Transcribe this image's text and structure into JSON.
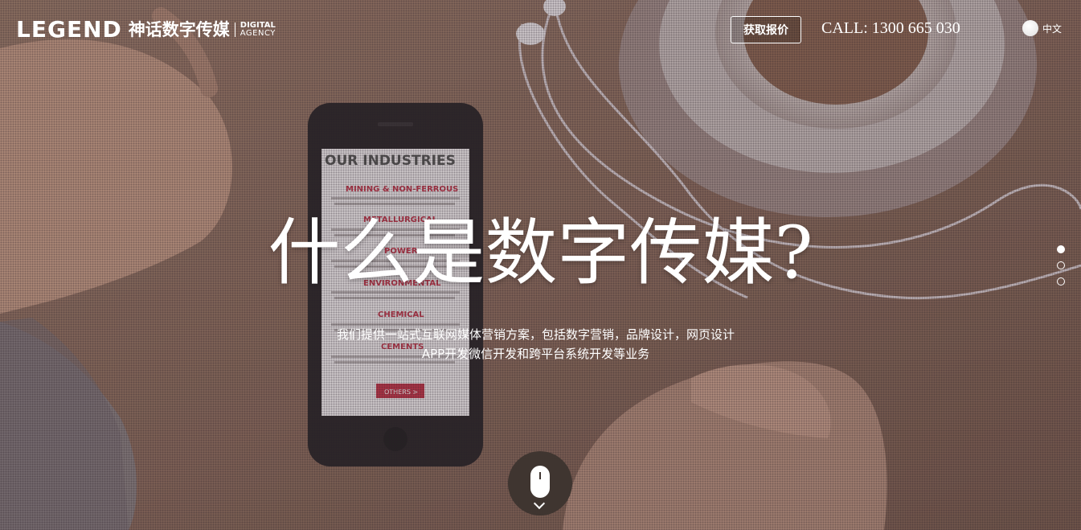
{
  "header": {
    "logo_en": "LEGEND",
    "logo_cn": "神话数字传媒",
    "logo_digital": "DIGITAL",
    "logo_agency": "AGENCY",
    "quote_button": "获取报价",
    "call": "CALL: 1300 665 030",
    "language": "中文"
  },
  "hero": {
    "headline": "什么是数字传媒?",
    "subtitle_line1": "我们提供一站式互联网媒体营销方案，包括数字营销，品牌设计，网页设计",
    "subtitle_line2": "APP开发微信开发和跨平台系统开发等业务"
  },
  "phone_screen": {
    "title": "OUR INDUSTRIES",
    "items": [
      "MINING & NON-FERROUS",
      "METALLURGICAL",
      "POWER",
      "ENVIRONMENTAL",
      "CHEMICAL",
      "CEMENTS"
    ],
    "button": "OTHERS"
  },
  "pager": {
    "count": 3,
    "active": 0
  },
  "colors": {
    "accent": "#ffffff",
    "scroll_bg": "#3f3530",
    "phone_red": "#c0344a"
  },
  "icons": {
    "language": "globe-icon",
    "scroll": "mouse-icon",
    "scroll_arrow": "chevron-down-icon"
  }
}
